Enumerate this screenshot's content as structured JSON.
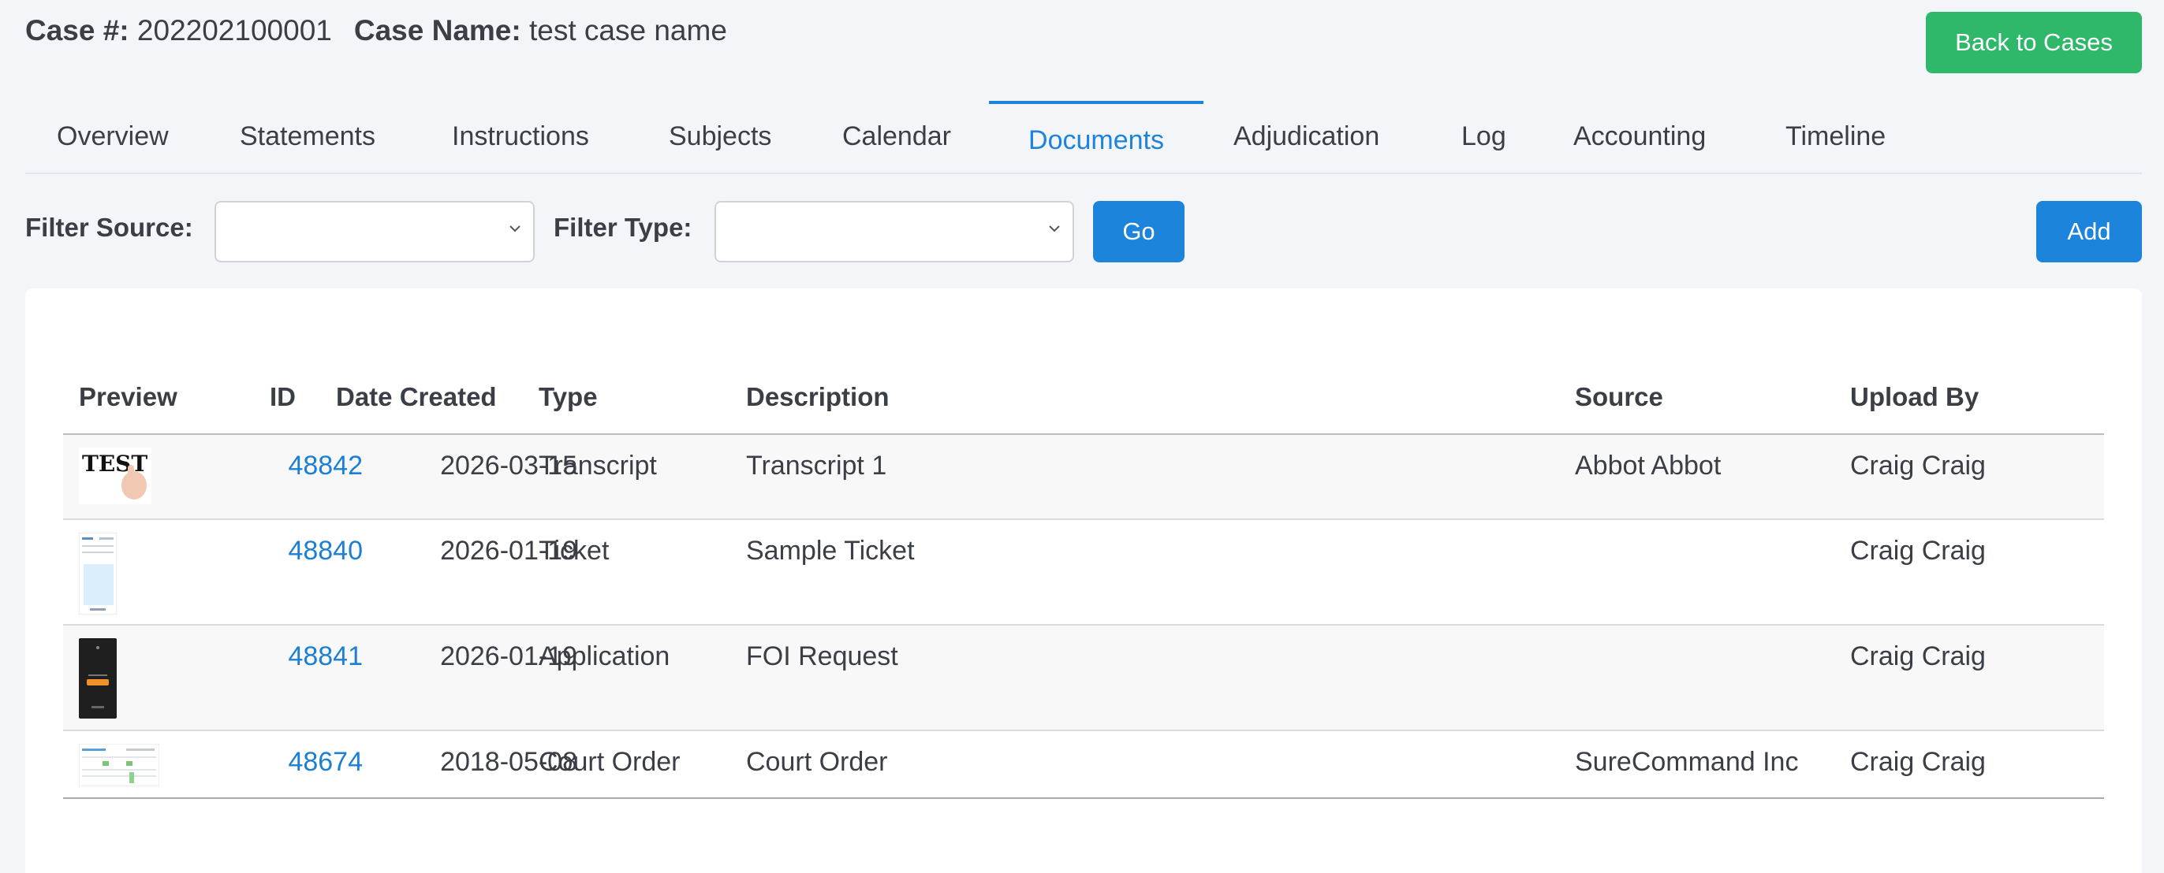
{
  "header": {
    "case_no_label": "Case #:",
    "case_no": "202202100001",
    "case_name_label": "Case Name:",
    "case_name": "test case name",
    "back_label": "Back to Cases"
  },
  "tabs": [
    {
      "label": "Overview"
    },
    {
      "label": "Statements"
    },
    {
      "label": "Instructions"
    },
    {
      "label": "Subjects"
    },
    {
      "label": "Calendar"
    },
    {
      "label": "Documents",
      "active": true
    },
    {
      "label": "Adjudication"
    },
    {
      "label": "Log"
    },
    {
      "label": "Accounting"
    },
    {
      "label": "Timeline"
    }
  ],
  "filters": {
    "source_label": "Filter Source:",
    "type_label": "Filter Type:",
    "go_label": "Go",
    "add_label": "Add"
  },
  "table": {
    "headers": {
      "preview": "Preview",
      "id": "ID",
      "date": "Date Created",
      "type": "Type",
      "description": "Description",
      "source": "Source",
      "upload_by": "Upload By"
    },
    "rows": [
      {
        "id": "48842",
        "date": "2026-03-15",
        "type": "Transcript",
        "description": "Transcript 1",
        "source": "Abbot Abbot",
        "upload_by": "Craig Craig",
        "preview_text": "TEST"
      },
      {
        "id": "48840",
        "date": "2026-01-19",
        "type": "Ticket",
        "description": "Sample Ticket",
        "source": "",
        "upload_by": "Craig Craig"
      },
      {
        "id": "48841",
        "date": "2026-01-19",
        "type": "Application",
        "description": "FOI Request",
        "source": "",
        "upload_by": "Craig Craig"
      },
      {
        "id": "48674",
        "date": "2018-05-08",
        "type": "Court Order",
        "description": "Court Order",
        "source": "SureCommand Inc",
        "upload_by": "Craig Craig"
      }
    ]
  },
  "colors": {
    "accent": "#1d84dc",
    "success": "#2fb86a"
  }
}
